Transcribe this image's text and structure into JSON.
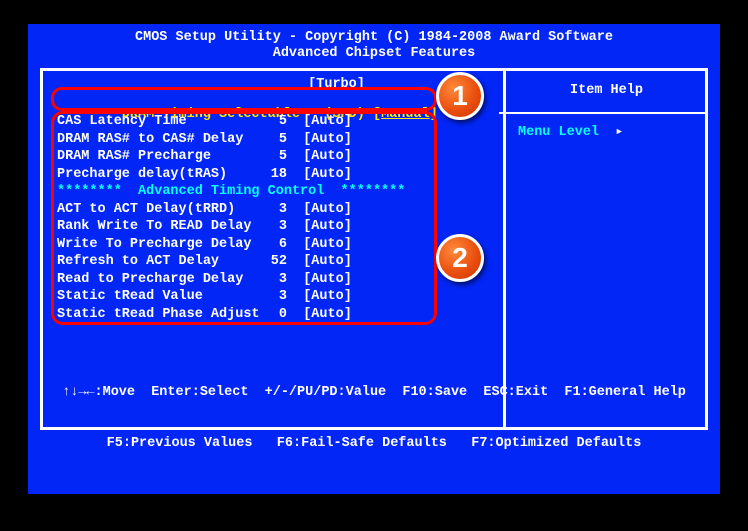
{
  "header": {
    "title1": "CMOS Setup Utility - Copyright (C) 1984-2008 Award Software",
    "title2": "Advanced Chipset Features"
  },
  "top_item": {
    "label": "DRAM Timing Selectable   (SPD)",
    "value": "Manual",
    "above": "[Turbo]"
  },
  "rows": [
    {
      "label": "CAS Latency Time",
      "val": "5",
      "auto": "[Auto]"
    },
    {
      "label": "DRAM RAS# to CAS# Delay",
      "val": "5",
      "auto": "[Auto]"
    },
    {
      "label": "DRAM RAS# Precharge",
      "val": "5",
      "auto": "[Auto]"
    },
    {
      "label": "Precharge delay(tRAS)",
      "val": "18",
      "auto": "[Auto]"
    }
  ],
  "section": "********  Advanced Timing Control  ********",
  "rows2": [
    {
      "label": "ACT to ACT Delay(tRRD)",
      "val": "3",
      "auto": "[Auto]"
    },
    {
      "label": "Rank Write To READ Delay",
      "val": "3",
      "auto": "[Auto]"
    },
    {
      "label": "Write To Precharge Delay",
      "val": "6",
      "auto": "[Auto]"
    },
    {
      "label": "Refresh to ACT Delay",
      "val": "52",
      "auto": "[Auto]"
    },
    {
      "label": "Read to Precharge Delay",
      "val": "3",
      "auto": "[Auto]"
    },
    {
      "label": "Static tRead Value",
      "val": "3",
      "auto": "[Auto]"
    },
    {
      "label": "Static tRead Phase Adjust",
      "val": "0",
      "auto": "[Auto]"
    }
  ],
  "right": {
    "item_help": "Item Help",
    "menu_level": "Menu Level"
  },
  "helpbar": {
    "line1": "↑↓→←:Move  Enter:Select  +/-/PU/PD:Value  F10:Save  ESC:Exit  F1:General Help",
    "line2": "F5:Previous Values   F6:Fail-Safe Defaults   F7:Optimized Defaults"
  },
  "callouts": {
    "one": "1",
    "two": "2"
  },
  "arrow": "▸"
}
